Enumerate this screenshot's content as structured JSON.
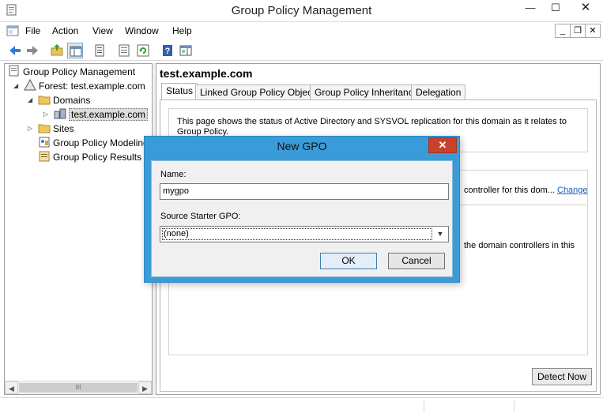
{
  "window": {
    "title": "Group Policy Management",
    "min": "—",
    "max": "☐",
    "close": "✕"
  },
  "menu": {
    "items": [
      "File",
      "Action",
      "View",
      "Window",
      "Help"
    ],
    "mdi": {
      "min": "_",
      "restore": "❐",
      "close": "✕"
    }
  },
  "toolbar": {
    "icons": [
      "back-arrow-icon",
      "forward-arrow-icon",
      "up-folder-icon",
      "show-hide-tree-icon",
      "properties-icon",
      "export-list-icon",
      "refresh-icon",
      "help-icon",
      "show-action-pane-icon"
    ]
  },
  "tree": {
    "items": [
      {
        "label": "Group Policy Management",
        "icon": "gpm-root-icon"
      },
      {
        "label": "Forest: test.example.com",
        "icon": "forest-icon"
      },
      {
        "label": "Domains",
        "icon": "folder-icon"
      },
      {
        "label": "test.example.com",
        "icon": "domain-icon"
      },
      {
        "label": "Sites",
        "icon": "folder-icon"
      },
      {
        "label": "Group Policy Modeling",
        "icon": "modeling-icon"
      },
      {
        "label": "Group Policy Results",
        "icon": "results-icon"
      }
    ],
    "scroll_thumb": "III"
  },
  "main": {
    "title": "test.example.com",
    "tabs": [
      {
        "label": "Status"
      },
      {
        "label": "Linked Group Policy Objects"
      },
      {
        "label": "Group Policy Inheritance"
      },
      {
        "label": "Delegation"
      }
    ],
    "info_text": "This page shows the status of Active Directory and SYSVOL replication for this domain as it relates to Group Policy.",
    "status_fragment_1": "controller for this dom...",
    "change_link": "Change",
    "status_fragment_2": "the domain controllers in this",
    "status_fragment_3": "",
    "detect_button": "Detect Now"
  },
  "dialog": {
    "title": "New GPO",
    "close": "✕",
    "name_label": "Name:",
    "name_value": "mygpo",
    "starter_label": "Source Starter GPO:",
    "starter_value": "(none)",
    "ok_label": "OK",
    "cancel_label": "Cancel"
  },
  "colors": {
    "dialog_frame": "#3a9bd9",
    "dialog_close": "#c7412c",
    "link": "#1a5fb4"
  }
}
